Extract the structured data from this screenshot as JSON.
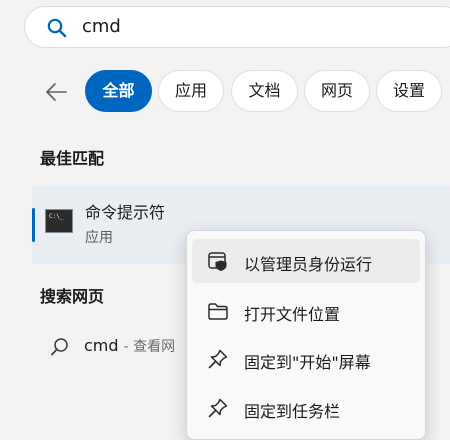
{
  "search": {
    "query": "cmd"
  },
  "filters": [
    {
      "label": "全部",
      "active": true
    },
    {
      "label": "应用",
      "active": false
    },
    {
      "label": "文档",
      "active": false
    },
    {
      "label": "网页",
      "active": false
    },
    {
      "label": "设置",
      "active": false
    }
  ],
  "sections": {
    "best_match": "最佳匹配",
    "web_search": "搜索网页"
  },
  "best_match": {
    "name": "命令提示符",
    "type": "应用",
    "icon": "command-prompt-icon"
  },
  "web_search": {
    "query": "cmd",
    "suffix": "- 查看网"
  },
  "context_menu": {
    "items": [
      {
        "label": "以管理员身份运行",
        "icon": "run-as-admin-icon"
      },
      {
        "label": "打开文件位置",
        "icon": "folder-icon"
      },
      {
        "label": "固定到\"开始\"屏幕",
        "icon": "pin-icon"
      },
      {
        "label": "固定到任务栏",
        "icon": "pin-icon"
      }
    ]
  },
  "colors": {
    "accent": "#0067c0",
    "background": "#f3f3f3",
    "card": "#e9eef3"
  }
}
